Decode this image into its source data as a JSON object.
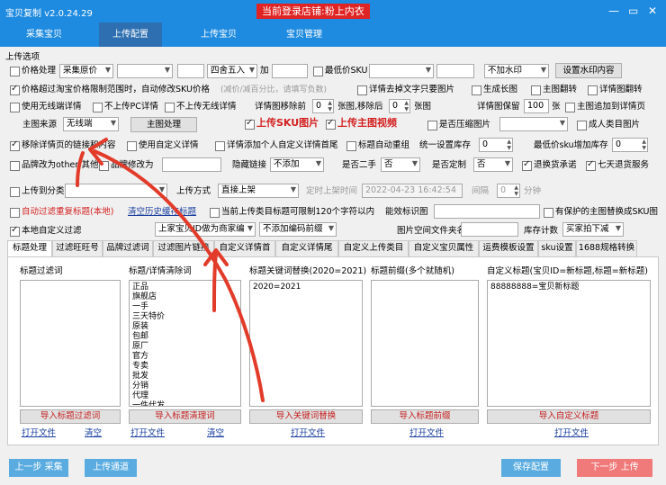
{
  "app": {
    "title": "宝贝复制 v2.0.24.29",
    "login": "当前登录店铺:粉上内衣",
    "controls": [
      "—",
      "▭",
      "✕"
    ]
  },
  "menu": [
    "采集宝贝",
    "上传配置",
    "上传宝贝",
    "宝贝管理"
  ],
  "section_title": "上传选项",
  "row1": {
    "price_cb": "价格处理",
    "price_src": "采集原价",
    "round": "四舍五入",
    "add": "加",
    "minsku": "最低价SKU",
    "watermark": "不加水印",
    "watermark_btn": "设置水印内容"
  },
  "row2": {
    "limit_cb": "价格超过淘宝价格限制范围时，自动修改SKU价格",
    "hint": "(减价/减百分比，请填写负数)",
    "detail_text": "详情去掉文字只要图片",
    "long_img": "生成长图",
    "main_flip": "主图翻转",
    "detail_flip": "详情图翻转"
  },
  "row3": {
    "wireless": "使用无线端详情",
    "no_pc": "不上传PC详情",
    "no_wireless": "不上传无线详情",
    "detail_move": "详情图移除前",
    "move_front_val": "0",
    "move_mid": "张图,移除后",
    "move_back_val": "0",
    "zhang": "张图",
    "keep": "详情图保留",
    "keep_val": "100",
    "zhang2": "张",
    "append": "主图追加到详情页"
  },
  "row4": {
    "main_src": "主图来源",
    "main_src_val": "无线端",
    "main_btn": "主图处理",
    "up_sku": "上传SKU图片",
    "up_video": "上传主图视频",
    "compress": "是否压缩图片",
    "adult": "成人类目图片"
  },
  "row5": {
    "remove_link": "移除详情页的链接和内容",
    "custom_detail": "使用自定义详情",
    "head_detail": "详情添加个人自定义详情首尾",
    "title_regroup": "标题自动重组",
    "stock": "统一设置库存",
    "stock_val": "0",
    "min_sku_add": "最低价sku增加库存",
    "min_sku_val": "0"
  },
  "row6": {
    "brand_other": "品牌改为other/其他",
    "brand_to": "品牌修改为",
    "hide_link": "隐藏链接",
    "hide_val": "不添加",
    "second_hand": "是否二手",
    "second_val": "否",
    "custom": "是否定制",
    "custom_val": "否",
    "refund": "退换货承诺",
    "seven": "七天退货服务"
  },
  "row7": {
    "category": "上传到分类",
    "method": "上传方式",
    "method_val": "直接上架",
    "timed": "定时上架时间",
    "datetime": "2022-04-23 16:42:54",
    "interval": "间隔",
    "interval_val": "0",
    "minute": "分钟"
  },
  "row8": {
    "auto_filter": "自动过滤重复标题(本地)",
    "clear_history": "清空历史缓存标题",
    "limit120": "当前上传类目标题可限制120个字符以内",
    "can_mark": "能效标识图",
    "protected": "有保护的主图替换成SKU图"
  },
  "row9": {
    "local_filter": "本地自定义过滤",
    "merchant": "上家宝贝ID做为商家编",
    "no_code": "不添加编码前缀",
    "folder": "图片空间文件夹名",
    "stock_count": "库存计数",
    "stock_count_val": "买家拍下减"
  },
  "tabs": [
    "标题处理",
    "过滤旺旺号",
    "品牌过滤词",
    "过滤图片链接",
    "自定义详情首",
    "自定义详情尾",
    "自定义上传类目",
    "自定义宝贝属性",
    "运费模板设置",
    "sku设置",
    "1688规格转换"
  ],
  "panels": [
    {
      "title": "标题过滤词",
      "content": "",
      "import": "导入标题过滤词",
      "open": "打开文件",
      "clear": "清空"
    },
    {
      "title": "标题/详情清除词",
      "content": "正品\n旗舰店\n一手\n三天特价\n原装\n包邮\n原厂\n官方\n专卖\n批发\n分销\n代理\n一件代发\n一件代发",
      "import": "导入标题清理词",
      "open": "打开文件",
      "clear": "清空"
    },
    {
      "title": "标题关键词替换(2020=2021)",
      "content": "2020=2021",
      "import": "导入关键词替换",
      "open": "打开文件"
    },
    {
      "title": "标题前缀(多个就随机)",
      "content": "",
      "import": "导入标题前缀",
      "open": "打开文件"
    },
    {
      "title": "自定义标题(宝贝ID=新标题,标题=新标题)",
      "content": "88888888=宝贝新标题",
      "import": "导入自定义标题",
      "open": "打开文件"
    }
  ],
  "bottom": {
    "prev": "上一步 采集",
    "channel": "上传通道",
    "save": "保存配置",
    "next": "下一步 上传"
  },
  "colors": {
    "titlebar": "#1f8be0",
    "menu_active": "#2d6fb0",
    "login": "#e02424",
    "red_text": "#d32020",
    "annotation": "#e23b2a",
    "save_btn": "#5aace0",
    "next_btn": "#f07a7a"
  }
}
